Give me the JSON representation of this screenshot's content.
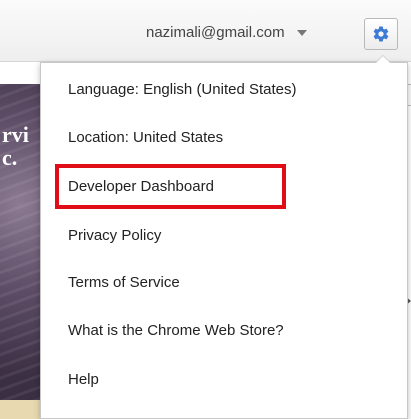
{
  "header": {
    "account_email": "nazimali@gmail.com",
    "settings_icon": "gear-icon",
    "dropdown_icon": "caret-down-icon"
  },
  "background": {
    "text_line_1": "rvi",
    "text_line_2": "c."
  },
  "menu": {
    "items": [
      {
        "label": "Language: English (United States)"
      },
      {
        "label": "Location: United States"
      },
      {
        "label": "Developer Dashboard",
        "highlighted": true
      },
      {
        "label": "Privacy Policy"
      },
      {
        "label": "Terms of Service"
      },
      {
        "label": "What is the Chrome Web Store?"
      },
      {
        "label": "Help"
      }
    ]
  },
  "colors": {
    "highlight_border": "#e00d16",
    "gear_icon": "#3f7bd6",
    "text": "#222222"
  }
}
